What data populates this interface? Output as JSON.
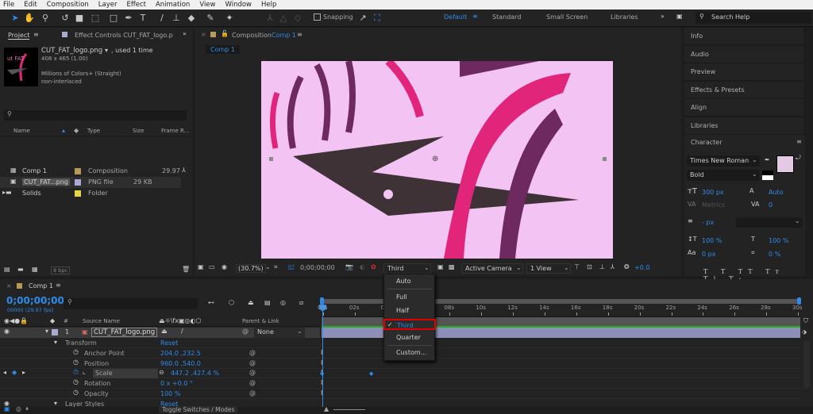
{
  "menubar": [
    "File",
    "Edit",
    "Composition",
    "Layer",
    "Effect",
    "Animation",
    "View",
    "Window",
    "Help"
  ],
  "toolbar": {
    "snapping_label": "Snapping",
    "snapping_checked": false
  },
  "workspaces": {
    "items": [
      "Default",
      "Standard",
      "Small Screen",
      "Libraries"
    ],
    "active": "Default",
    "search_placeholder": "Search Help"
  },
  "project": {
    "tab": "Project",
    "effect_controls_tab": "Effect Controls  CUT_FAT_logo.p",
    "selected_name": "CUT_FAT_logo.png",
    "used": ", used 1 time",
    "dims": "408 x 465 (1.00)",
    "colors": "Millions of Colors+ (Straight)",
    "interlace": "non-interlaced",
    "columns": [
      "Name",
      "Type",
      "Size",
      "Frame R..."
    ],
    "items": [
      {
        "name": "Comp 1",
        "type": "Composition",
        "size": "",
        "frame_rate": "29.97",
        "label_color": "#b59a5c"
      },
      {
        "name": "CUT_FAT...png",
        "type": "PNG file",
        "size": "29 KB",
        "frame_rate": "",
        "label_color": "#a9a9d6"
      },
      {
        "name": "Solids",
        "type": "Folder",
        "size": "",
        "frame_rate": "",
        "label_color": "#e8d34a"
      }
    ],
    "bpc": "8 bpc"
  },
  "composition": {
    "tab_prefix": "Composition",
    "tab_name": "Comp 1",
    "breadcrumb": "Comp 1",
    "zoom": "(30.7%)",
    "timecode": "0;00;00;00",
    "resolution": "Third",
    "camera": "Active Camera",
    "views": "1 View",
    "exposure": "+0.0",
    "canvas_color": "#f3c3f3"
  },
  "resolution_menu": {
    "items": [
      "Auto",
      "Full",
      "Half",
      "Third",
      "Quarter",
      "Custom..."
    ],
    "selected": "Third",
    "highlight_color": "#e00000"
  },
  "right_panels": [
    "Info",
    "Audio",
    "Preview",
    "Effects & Presets",
    "Align",
    "Libraries"
  ],
  "character": {
    "title": "Character",
    "font": "Times New Roman",
    "style": "Bold",
    "size": "300 px",
    "leading": "Auto",
    "kerning": "Metrics",
    "tracking": "0",
    "stroke": "- px",
    "vscale": "100 %",
    "hscale": "100 %",
    "baseline": "0 px",
    "tsume": "0 %",
    "fill_color": "#e3c9e3"
  },
  "timeline": {
    "tab": "Comp 1",
    "timecode": "0;00;00;00",
    "fps": "00000 (29.97 fps)",
    "columns": {
      "source": "Source Name",
      "parent": "Parent & Link",
      "num": "#"
    },
    "layer": {
      "num": "1",
      "name": "CUT_FAT_logo.png",
      "parent": "None"
    },
    "props": [
      {
        "name": "Transform",
        "value": "Reset",
        "group": true
      },
      {
        "name": "Anchor Point",
        "value": "204.0 ,232.5"
      },
      {
        "name": "Position",
        "value": "960.0 ,540.0"
      },
      {
        "name": "Scale",
        "value": "447.2 ,427.4 %"
      },
      {
        "name": "Rotation",
        "value": "0 x +0.0 °"
      },
      {
        "name": "Opacity",
        "value": "100 %"
      },
      {
        "name": "Layer Styles",
        "value": "Reset",
        "group": true
      }
    ],
    "ruler": [
      "00s",
      "02s",
      "04s",
      "06s",
      "08s",
      "10s",
      "12s",
      "14s",
      "16s",
      "18s",
      "20s",
      "22s",
      "24s",
      "26s",
      "28s",
      "30s"
    ],
    "toggle_label": "Toggle Switches / Modes"
  }
}
